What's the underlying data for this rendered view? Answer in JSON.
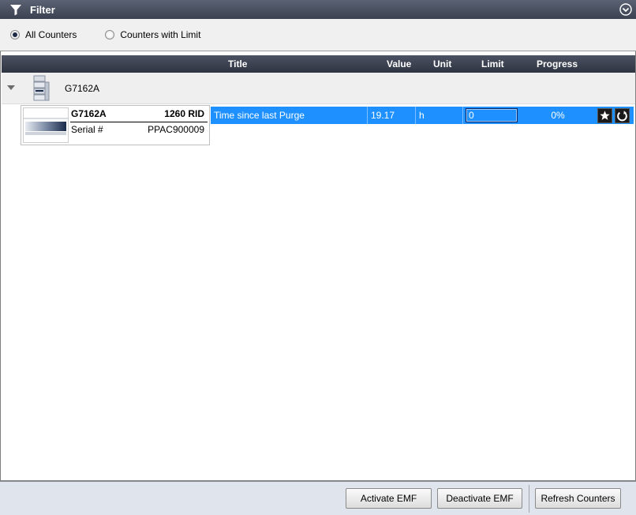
{
  "filter": {
    "title": "Filter"
  },
  "radios": [
    {
      "label": "All Counters",
      "checked": true
    },
    {
      "label": "Counters with Limit",
      "checked": false
    }
  ],
  "columns": {
    "title": "Title",
    "value": "Value",
    "unit": "Unit",
    "limit": "Limit",
    "progress": "Progress"
  },
  "group": {
    "name": "G7162A"
  },
  "module": {
    "model": "G7162A",
    "product": "1260 RID",
    "serial_label": "Serial #",
    "serial": "PPAC900009"
  },
  "counter": {
    "title": "Time since last Purge",
    "value": "19.17",
    "unit": "h",
    "limit": "0",
    "progress": "0%",
    "progress_fraction": 0
  },
  "footer": {
    "activate": "Activate EMF",
    "deactivate": "Deactivate EMF",
    "refresh": "Refresh Counters"
  }
}
